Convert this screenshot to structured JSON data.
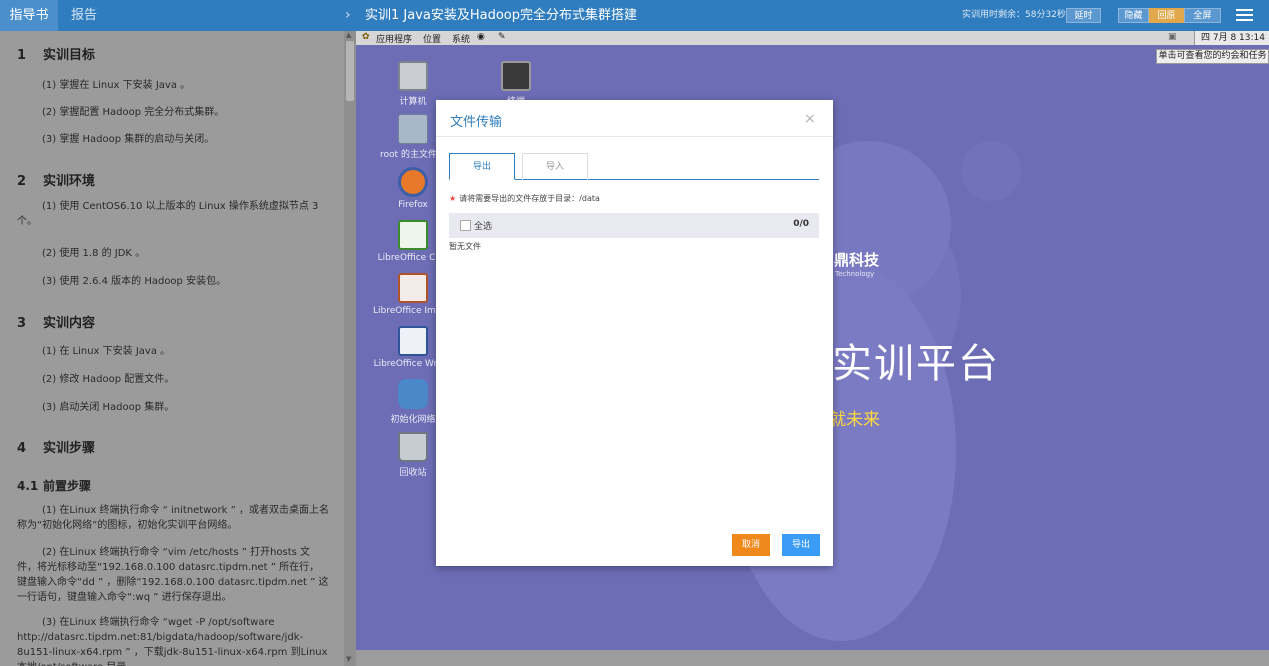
{
  "topbar": {
    "tab_guide": "指导书",
    "tab_report": "报告",
    "chevron": "›",
    "course_title": "实训1 Java安装及Hadoop完全分布式集群搭建",
    "timer_text": "实训用时剩余：58分32秒",
    "btn_extend": "延时",
    "btn_hide": "隐藏",
    "btn_restore": "回原",
    "btn_fullscreen": "全屏",
    "menu_icon": "hamburger-menu-icon"
  },
  "guide": {
    "s1_num": "1",
    "s1_title": "实训目标",
    "s1_items": [
      "(1)  掌握在 Linux 下安装 Java 。",
      "(2)  掌握配置 Hadoop 完全分布式集群。",
      "(3)  掌握 Hadoop 集群的启动与关闭。"
    ],
    "s2_num": "2",
    "s2_title": "实训环境",
    "s2_item1": "(1)  使用 CentOS6.10 以上版本的 Linux 操作系统虚拟节点 3 个。",
    "s2_items": [
      "(2)  使用 1.8 的 JDK 。",
      "(3)  使用 2.6.4 版本的 Hadoop 安装包。"
    ],
    "s3_num": "3",
    "s3_title": "实训内容",
    "s3_items": [
      "(1)  在 Linux 下安装 Java 。",
      "(2)  修改 Hadoop 配置文件。",
      "(3)  启动关闭 Hadoop 集群。"
    ],
    "s4_num": "4",
    "s4_title": "实训步骤",
    "s41_num": "4.1",
    "s41_title": "前置步骤",
    "p1": "(1)  在Linux 终端执行命令 “ initnetwork ” ，或者双击桌面上名称为“初始化网络”的图标，初始化实训平台网络。",
    "p2": "(2)  在Linux 终端执行命令 “vim /etc/hosts ” 打开hosts 文件，将光标移动至“192.168.0.100 datasrc.tipdm.net ” 所在行，键盘输入命令“dd ” ，删除“192.168.0.100 datasrc.tipdm.net ” 这一行语句，键盘输入命令“:wq ” 进行保存退出。",
    "p3": "(3)  在Linux 终端执行命令 “wget -P /opt/software http://datasrc.tipdm.net:81/bigdata/hadoop/software/jdk-8u151-linux-x64.rpm ” ，下载jdk-8u151-linux-x64.rpm 到Linux 本地/opt/software 目录。"
  },
  "desktop": {
    "panel": {
      "apps": "应用程序",
      "places": "位置",
      "system": "系统",
      "clock": "四  7月   8 13:14"
    },
    "tip": "单击可查看您的约会和任务",
    "icons": [
      {
        "label": "计算机",
        "icon": "computer-icon"
      },
      {
        "label": "终端",
        "icon": "terminal-icon"
      },
      {
        "label": "root 的主文件夹",
        "icon": "home-folder-icon"
      },
      {
        "label": "Firefox",
        "icon": "firefox-icon"
      },
      {
        "label": "LibreOffice Calc",
        "icon": "libreoffice-calc-icon"
      },
      {
        "label": "LibreOffice Impress",
        "icon": "libreoffice-impress-icon"
      },
      {
        "label": "LibreOffice Writer",
        "icon": "libreoffice-writer-icon"
      },
      {
        "label": "初始化网络",
        "icon": "init-network-icon"
      },
      {
        "label": "回收站",
        "icon": "trash-icon"
      }
    ],
    "brand_logo": "鼎科技",
    "brand_logo_en": "Technology",
    "brand_title": "实训平台",
    "brand_slogan": "就未来",
    "bg_color": "#6d6db6"
  },
  "dialog": {
    "title": "文件传输",
    "close": "×",
    "tab_export": "导出",
    "tab_import": "导入",
    "hint_star": "★",
    "hint": "请将需要导出的文件存放于目录：/data",
    "select_all": "全选",
    "count": "0/0",
    "empty": "暂无文件",
    "btn_cancel": "取消",
    "btn_export": "导出",
    "accent": "#2f7dbf",
    "cancel_color": "#f0891c",
    "export_color": "#3a9cf5"
  }
}
